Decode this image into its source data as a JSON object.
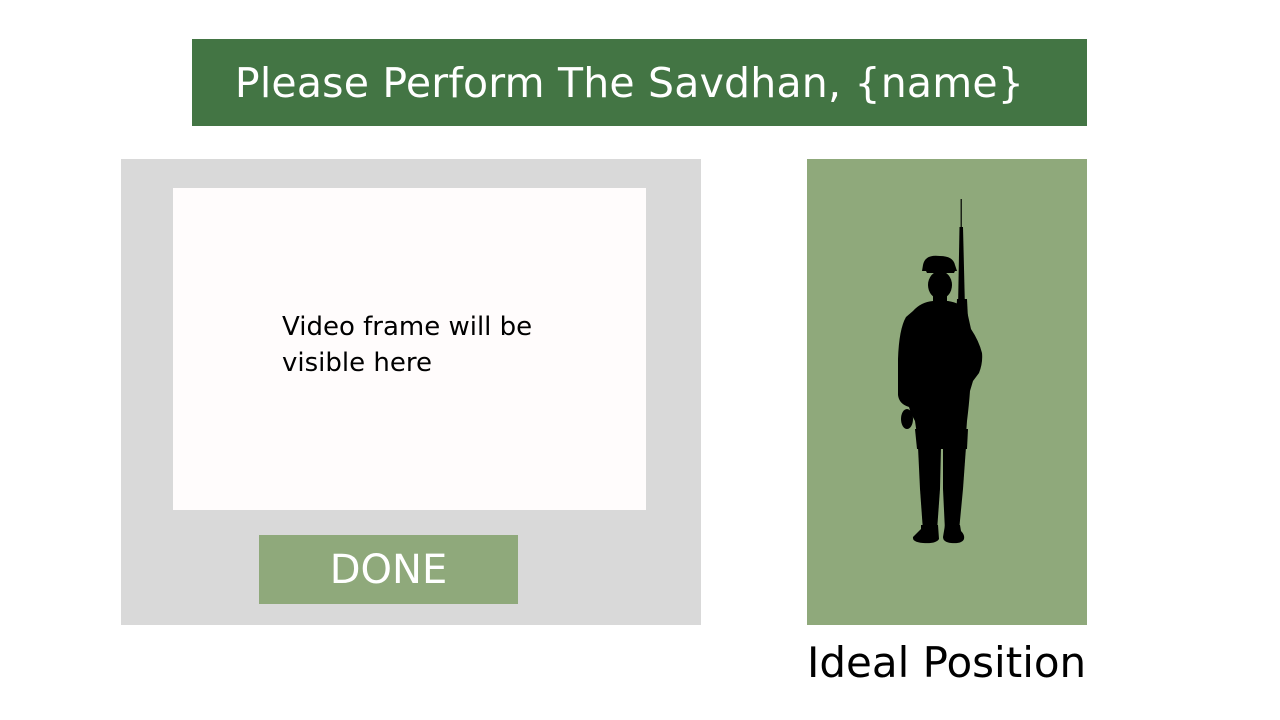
{
  "header": {
    "title": "Please Perform The Savdhan, {name}"
  },
  "capture": {
    "video_placeholder": "Video frame will be visible here",
    "done_label": "DONE"
  },
  "ideal": {
    "label": "Ideal Position",
    "figure_icon": "soldier-silhouette-icon"
  },
  "colors": {
    "header_bg": "#437544",
    "accent_green": "#8fa97b",
    "panel_gray": "#d9d9d9",
    "frame_bg": "#fffcfc"
  }
}
